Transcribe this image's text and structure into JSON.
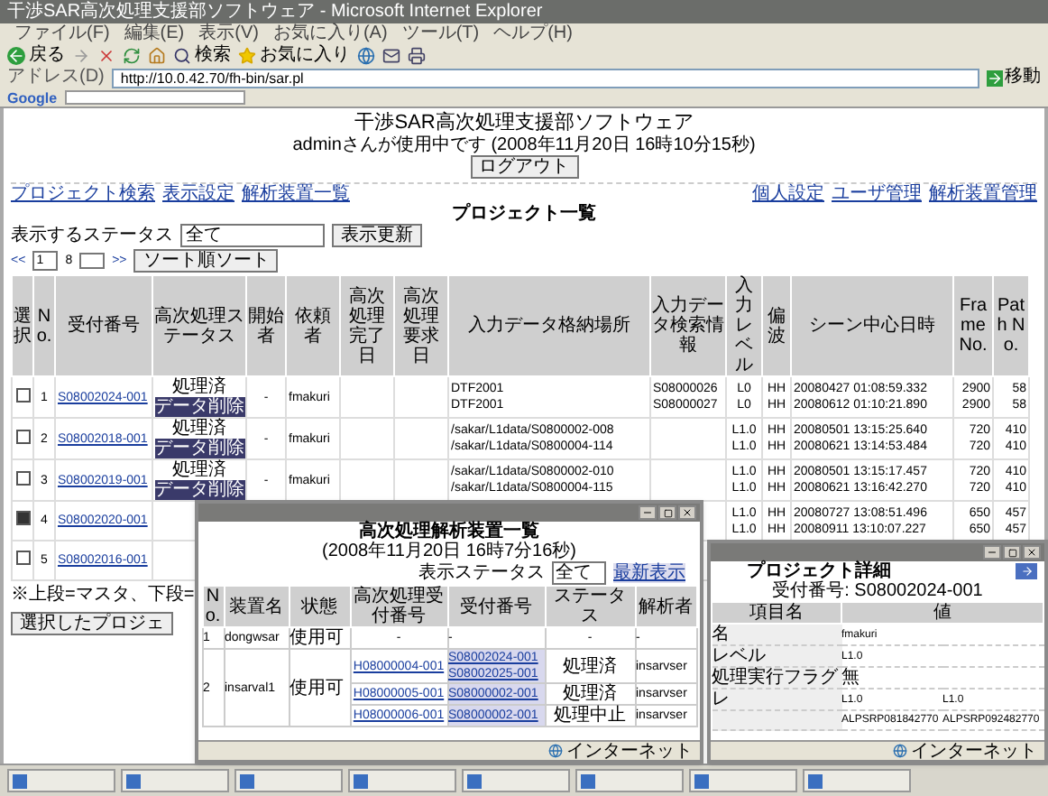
{
  "browser": {
    "title": "干渉SAR高次処理支援部ソフトウェア - Microsoft Internet Explorer",
    "menu": [
      "ファイル(F)",
      "編集(E)",
      "表示(V)",
      "お気に入り(A)",
      "ツール(T)",
      "ヘルプ(H)"
    ],
    "back": "戻る",
    "search": "検索",
    "favorites": "お気に入り",
    "address_label": "アドレス(D)",
    "address": "http://10.0.42.70/fh-bin/sar.pl",
    "go": "移動",
    "google": "Google"
  },
  "page": {
    "title": "干渉SAR高次処理支援部ソフトウェア",
    "user_line": "adminさんが使用中です (2008年11月20日 16時10分15秒)",
    "logout": "ログアウト",
    "left_links": [
      "プロジェクト検索",
      "表示設定",
      "解析装置一覧"
    ],
    "right_links": [
      "個人設定",
      "ユーザ管理",
      "解析装置管理"
    ],
    "list_title": "プロジェクト一覧",
    "status_label": "表示するステータス",
    "status_value": "全て",
    "refresh": "表示更新",
    "pager": {
      "first": "<<",
      "page": "1",
      "count": "8",
      "last": ">>",
      "sort": "ソート順ソート"
    },
    "note": "※上段=マスタ、下段=",
    "selected_button": "選択したプロジェ"
  },
  "table": {
    "columns": [
      "選択",
      "No.",
      "受付番号",
      "高次処理ステータス",
      "開始者",
      "依頼者",
      "高次処理完了日",
      "高次処理要求日",
      "入力データ格納場所",
      "入力データ検索情報",
      "入力レベル",
      "偏波",
      "シーン中心日時",
      "Frame No.",
      "Path No."
    ],
    "rows": [
      {
        "checked": false,
        "no": "1",
        "id": "S08002024-001",
        "status": "処理済",
        "status_button": "データ削除",
        "start": "-",
        "requester": "fmakuri",
        "location": [
          "DTF2001",
          "DTF2001"
        ],
        "search": [
          "S08000026",
          "S08000027"
        ],
        "level": [
          "L0",
          "L0"
        ],
        "polarization": [
          "HH",
          "HH"
        ],
        "scene_time": [
          "20080427 01:08:59.332",
          "20080612 01:10:21.890"
        ],
        "frame": [
          "2900",
          "2900"
        ],
        "path": [
          "58",
          "58"
        ]
      },
      {
        "checked": false,
        "no": "2",
        "id": "S08002018-001",
        "status": "処理済",
        "status_button": "データ削除",
        "start": "-",
        "requester": "fmakuri",
        "location": [
          "/sakar/L1data/S0800002-008",
          "/sakar/L1data/S0800004-114"
        ],
        "level": [
          "L1.0",
          "L1.0"
        ],
        "polarization": [
          "HH",
          "HH"
        ],
        "scene_time": [
          "20080501 13:15:25.640",
          "20080621 13:14:53.484"
        ],
        "frame": [
          "720",
          "720"
        ],
        "path": [
          "410",
          "410"
        ]
      },
      {
        "checked": false,
        "no": "3",
        "id": "S08002019-001",
        "status": "処理済",
        "status_button": "データ削除",
        "start": "-",
        "requester": "fmakuri",
        "location": [
          "/sakar/L1data/S0800002-010",
          "/sakar/L1data/S0800004-115"
        ],
        "level": [
          "L1.0",
          "L1.0"
        ],
        "polarization": [
          "HH",
          "HH"
        ],
        "scene_time": [
          "20080501 13:15:17.457",
          "20080621 13:16:42.270"
        ],
        "frame": [
          "720",
          "720"
        ],
        "path": [
          "410",
          "410"
        ]
      },
      {
        "checked": true,
        "no": "4",
        "id": "S08002020-001",
        "level": [
          "L1.0",
          "L1.0"
        ],
        "polarization": [
          "HH",
          "HH"
        ],
        "scene_time": [
          "20080727 13:08:51.496",
          "20080911 13:10:07.227"
        ],
        "frame": [
          "650",
          "650"
        ],
        "path": [
          "457",
          "457"
        ]
      },
      {
        "checked": false,
        "no": "5",
        "id": "S08002016-001"
      }
    ]
  },
  "devices_window": {
    "title": "高次処理解析装置一覧",
    "date": "(2008年11月20日 16時7分16秒)",
    "link": "最新表示",
    "status_label": "表示ステータス",
    "status_value": "全て",
    "columns": [
      "No.",
      "装置名",
      "状態",
      "高次処理受付番号",
      "受付番号",
      "ステータス",
      "解析者"
    ],
    "devices": [
      {
        "no": "1",
        "name": "dongwsar",
        "state": "使用可",
        "jobs": [
          {
            "kind": "none",
            "job": "-",
            "ids": [
              "-"
            ],
            "status": "-",
            "analyst": "-"
          }
        ]
      },
      {
        "no": "2",
        "name": "insarval1",
        "state": "使用可",
        "jobs": [
          {
            "kind": "link",
            "job": "H08000004-001",
            "ids": [
              "S08002024-001",
              "S08002025-001"
            ],
            "status": "処理済",
            "analyst": "insarvser"
          },
          {
            "kind": "link",
            "job": "H08000005-001",
            "ids": [
              "S08000002-001"
            ],
            "status": "処理済",
            "analyst": "insarvser"
          },
          {
            "kind": "link",
            "job": "H08000006-001",
            "ids": [
              "S08000002-001"
            ],
            "status": "処理中止",
            "analyst": "insarvser"
          }
        ]
      }
    ],
    "footer": "インターネット"
  },
  "detail_window": {
    "title": "プロジェクト詳細",
    "id_line": "受付番号: S08002024-001",
    "columns": [
      "項目名",
      "値"
    ],
    "rows": [
      {
        "label": "名",
        "values": [
          "fmakuri"
        ]
      },
      {
        "label": "レベル",
        "values": [
          "L1.0"
        ]
      },
      {
        "label": "処理実行フラグ",
        "values": [
          "無"
        ]
      },
      {
        "label": "レ",
        "values": [
          "L1.0",
          "L1.0"
        ]
      },
      {
        "values": [
          "ALPSRP081842770",
          "ALPSRP092482770"
        ]
      }
    ],
    "footer": "インターネット"
  }
}
